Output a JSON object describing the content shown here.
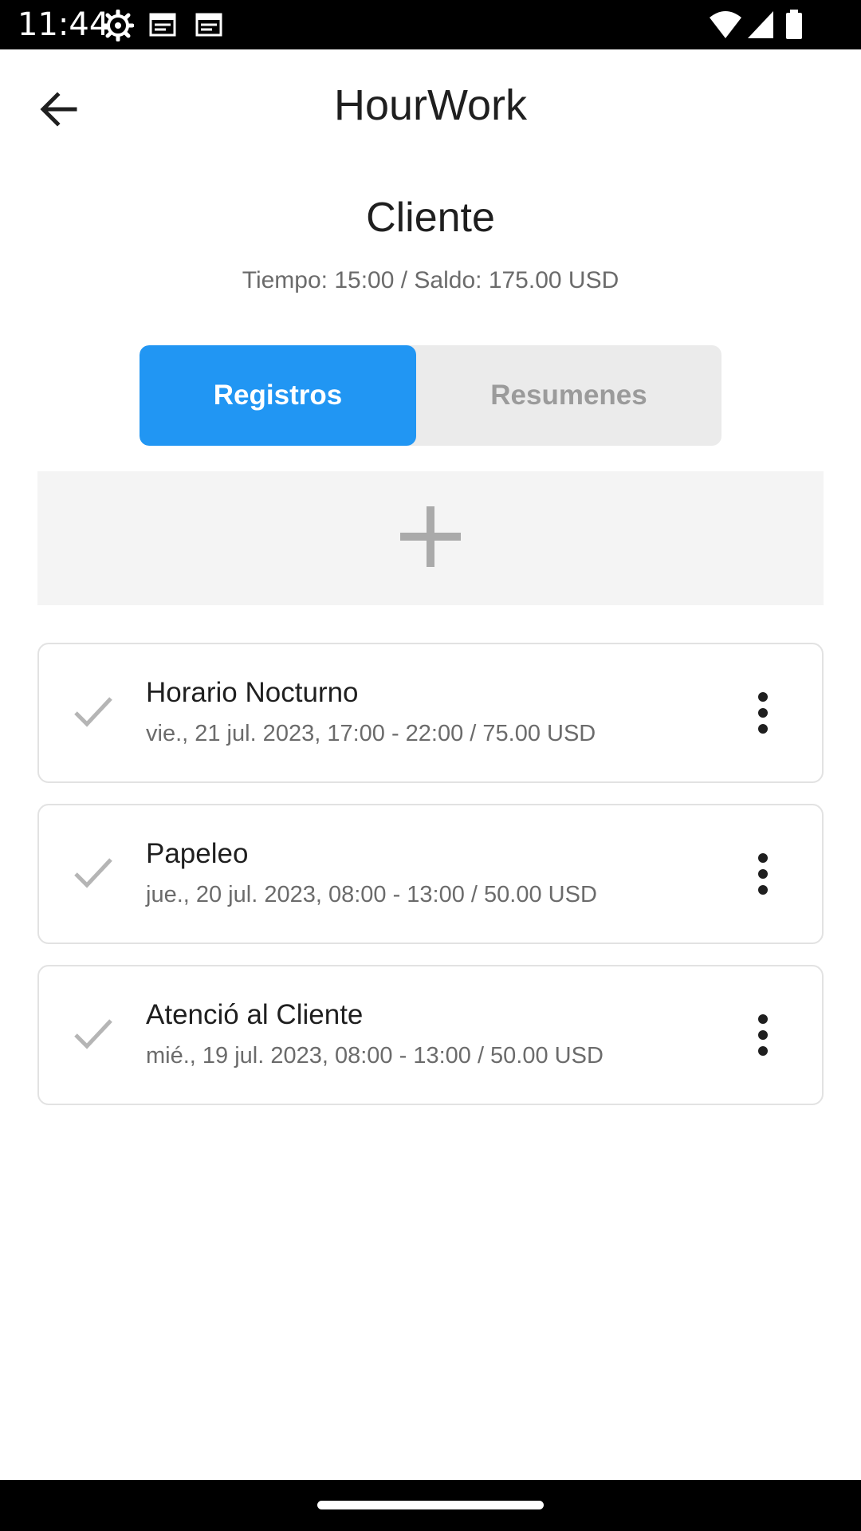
{
  "status_bar": {
    "time": "11:44",
    "icons": [
      "settings-gear-icon",
      "calendar-icon",
      "calendar-icon",
      "wifi-icon",
      "signal-icon",
      "battery-icon"
    ]
  },
  "app_bar": {
    "title": "HourWork",
    "back_icon": "arrow-left-icon"
  },
  "client": {
    "name": "Cliente",
    "summary": "Tiempo: 15:00 / Saldo: 175.00 USD"
  },
  "tabs": [
    {
      "label": "Registros",
      "active": true
    },
    {
      "label": "Resumenes",
      "active": false
    }
  ],
  "add_button": {
    "icon": "plus-icon"
  },
  "records": [
    {
      "title": "Horario Nocturno",
      "detail": "vie., 21 jul. 2023, 17:00 - 22:00 / 75.00 USD"
    },
    {
      "title": "Papeleo",
      "detail": "jue., 20 jul. 2023, 08:00 - 13:00 / 50.00 USD"
    },
    {
      "title": "Atenció al Cliente",
      "detail": "mié., 19 jul. 2023, 08:00 - 13:00 / 50.00 USD"
    }
  ],
  "colors": {
    "accent": "#2196f3",
    "segment_bg": "#ebebeb",
    "add_bg": "#f4f4f4",
    "card_border": "#e2e2e2",
    "secondary_text": "#6b6b6b"
  }
}
